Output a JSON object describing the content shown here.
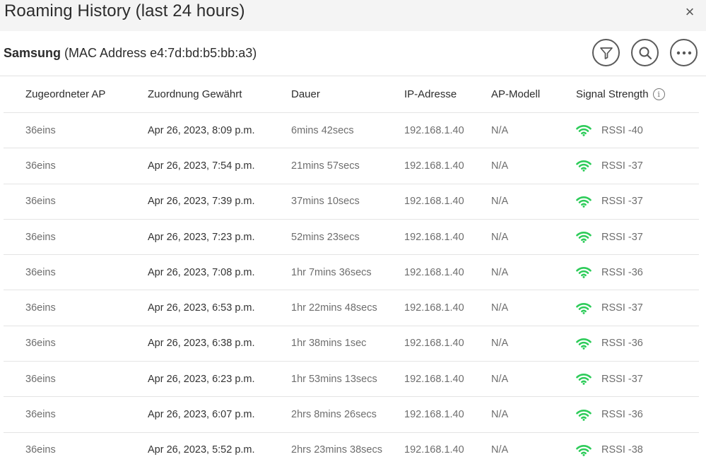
{
  "dialog": {
    "title": "Roaming History (last 24 hours)",
    "close_symbol": "×"
  },
  "device": {
    "name": "Samsung",
    "mac_text": "(MAC Address e4:7d:bd:b5:bb:a3)"
  },
  "actions": [
    "filter-icon",
    "search-icon",
    "more-icon"
  ],
  "colors": {
    "signal_good": "#2ecc5a",
    "title_bar_bg": "#f4f4f4"
  },
  "table": {
    "columns": [
      "Zugeordneter AP",
      "Zuordnung Gewährt",
      "Dauer",
      "IP-Adresse",
      "AP-Modell",
      "Signal Strength"
    ],
    "rows": [
      {
        "ap": "36eins",
        "granted": "Apr 26, 2023, 8:09 p.m.",
        "duration": "6mins 42secs",
        "ip": "192.168.1.40",
        "model": "N/A",
        "signal": "RSSI -40"
      },
      {
        "ap": "36eins",
        "granted": "Apr 26, 2023, 7:54 p.m.",
        "duration": "21mins 57secs",
        "ip": "192.168.1.40",
        "model": "N/A",
        "signal": "RSSI -37"
      },
      {
        "ap": "36eins",
        "granted": "Apr 26, 2023, 7:39 p.m.",
        "duration": "37mins 10secs",
        "ip": "192.168.1.40",
        "model": "N/A",
        "signal": "RSSI -37"
      },
      {
        "ap": "36eins",
        "granted": "Apr 26, 2023, 7:23 p.m.",
        "duration": "52mins 23secs",
        "ip": "192.168.1.40",
        "model": "N/A",
        "signal": "RSSI -37"
      },
      {
        "ap": "36eins",
        "granted": "Apr 26, 2023, 7:08 p.m.",
        "duration": "1hr 7mins 36secs",
        "ip": "192.168.1.40",
        "model": "N/A",
        "signal": "RSSI -36"
      },
      {
        "ap": "36eins",
        "granted": "Apr 26, 2023, 6:53 p.m.",
        "duration": "1hr 22mins 48secs",
        "ip": "192.168.1.40",
        "model": "N/A",
        "signal": "RSSI -37"
      },
      {
        "ap": "36eins",
        "granted": "Apr 26, 2023, 6:38 p.m.",
        "duration": "1hr 38mins 1sec",
        "ip": "192.168.1.40",
        "model": "N/A",
        "signal": "RSSI -36"
      },
      {
        "ap": "36eins",
        "granted": "Apr 26, 2023, 6:23 p.m.",
        "duration": "1hr 53mins 13secs",
        "ip": "192.168.1.40",
        "model": "N/A",
        "signal": "RSSI -37"
      },
      {
        "ap": "36eins",
        "granted": "Apr 26, 2023, 6:07 p.m.",
        "duration": "2hrs 8mins 26secs",
        "ip": "192.168.1.40",
        "model": "N/A",
        "signal": "RSSI -36"
      },
      {
        "ap": "36eins",
        "granted": "Apr 26, 2023, 5:52 p.m.",
        "duration": "2hrs 23mins 38secs",
        "ip": "192.168.1.40",
        "model": "N/A",
        "signal": "RSSI -38"
      }
    ]
  }
}
